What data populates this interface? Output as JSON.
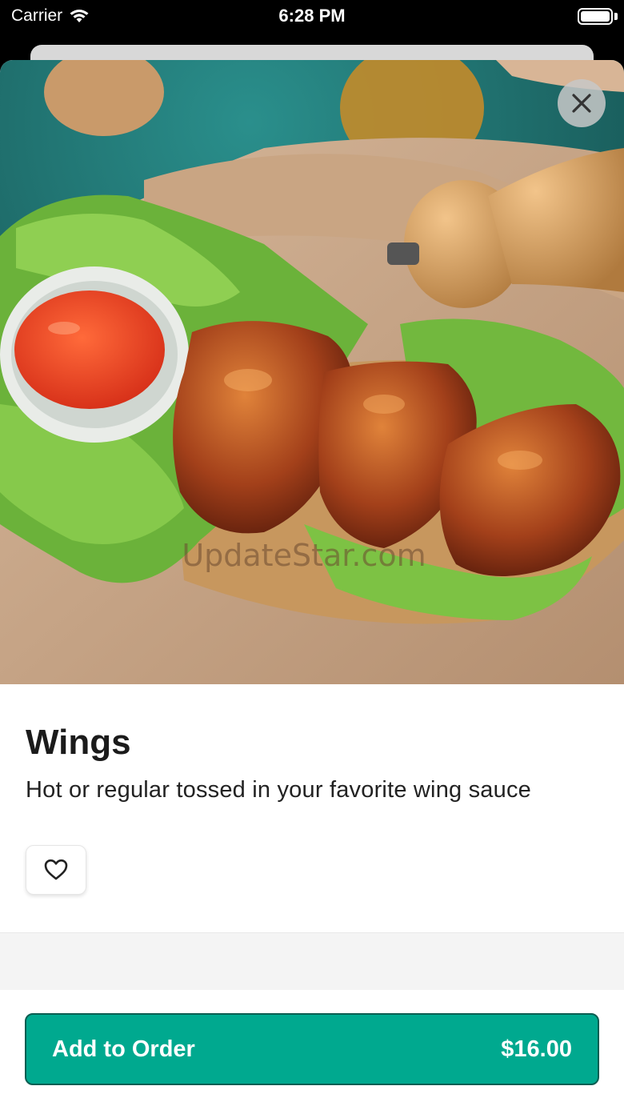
{
  "status_bar": {
    "carrier": "Carrier",
    "time": "6:28 PM"
  },
  "item": {
    "name": "Wings",
    "description": "Hot or regular tossed in your favorite wing sauce"
  },
  "image": {
    "watermark": "UpdateStar.com"
  },
  "actions": {
    "add_label": "Add to Order",
    "price": "$16.00"
  },
  "icons": {
    "close": "close-icon",
    "favorite": "heart-outline-icon",
    "wifi": "wifi-icon",
    "battery": "battery-icon"
  },
  "colors": {
    "accent": "#00a98f",
    "accent_border": "#0b5e52"
  }
}
